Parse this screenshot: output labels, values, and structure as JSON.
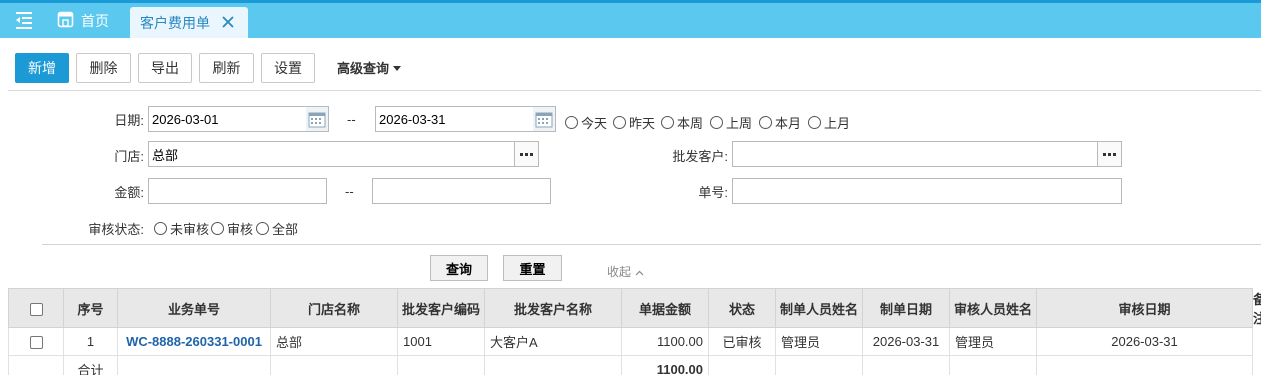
{
  "tabs": {
    "home_label": "首页",
    "active_label": "客户费用单"
  },
  "toolbar": {
    "add": "新增",
    "delete": "删除",
    "export": "导出",
    "refresh": "刷新",
    "settings": "设置",
    "advanced": "高级查询"
  },
  "form": {
    "date_label": "日期:",
    "date_from": "2026-03-01",
    "date_sep": "--",
    "date_to": "2026-03-31",
    "quick_dates": [
      "今天",
      "昨天",
      "本周",
      "上周",
      "本月",
      "上月"
    ],
    "store_label": "门店:",
    "store_value": "总部",
    "customer_label": "批发客户:",
    "customer_value": "",
    "amount_label": "金额:",
    "amount_from": "",
    "amount_sep": "--",
    "amount_to": "",
    "order_label": "单号:",
    "order_value": "",
    "audit_label": "审核状态:",
    "audit_options": [
      "未审核",
      "审核",
      "全部"
    ]
  },
  "actions": {
    "query": "查询",
    "reset": "重置",
    "collapse": "收起"
  },
  "table": {
    "headers": [
      "序号",
      "业务单号",
      "门店名称",
      "批发客户编码",
      "批发客户名称",
      "单据金额",
      "状态",
      "制单人员姓名",
      "制单日期",
      "审核人员姓名",
      "审核日期",
      "备注"
    ],
    "rows": [
      {
        "seq": "1",
        "order_no": "WC-8888-260331-0001",
        "store": "总部",
        "customer_code": "1001",
        "customer_name": "大客户A",
        "amount": "1100.00",
        "status": "已审核",
        "creator": "管理员",
        "create_date": "2026-03-31",
        "auditor": "管理员",
        "audit_date": "2026-03-31",
        "remark": ""
      }
    ],
    "total_label": "合计",
    "total_amount": "1100.00"
  },
  "colors": {
    "topbar": "#5bc8f0",
    "primary": "#1b9ad6",
    "link": "#1f64a8"
  }
}
